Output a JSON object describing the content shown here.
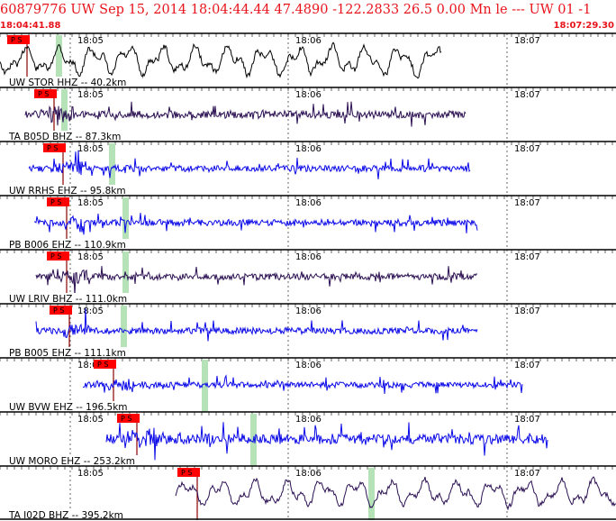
{
  "header": {
    "title": "60879776 UW Sep 15, 2014 18:04:44.44   47.4890 -122.2833 26.5 0.00 Mn le --- UW 01   -1",
    "start_time": "18:04:41.88",
    "end_time": "18:07:29.30"
  },
  "time_axis": {
    "tick_labels": [
      "18:05",
      "18:06",
      "18:07"
    ]
  },
  "colors": {
    "header_red": "#e8141c",
    "pick_box": "#ff0000",
    "s_window": "#b6e2b8",
    "trace_black": "#000000",
    "trace_purple": "#2a0f52",
    "trace_blue": "#0a08e8"
  },
  "traces": [
    {
      "label": "UW STOR HHZ -- 40.2km",
      "pick_label": "P S",
      "color": "#000000"
    },
    {
      "label": "TA B05D BHZ -- 87.3km",
      "pick_label": "P S",
      "color": "#2a0f52"
    },
    {
      "label": "UW RRHS EHZ -- 95.8km",
      "pick_label": "P S",
      "color": "#0a08e8"
    },
    {
      "label": "PB B006 EHZ -- 110.9km",
      "pick_label": "P S",
      "color": "#0a08e8"
    },
    {
      "label": "UW LRIV BHZ -- 111.0km",
      "pick_label": "P S",
      "color": "#2a0f52"
    },
    {
      "label": "PB B005 EHZ -- 111.1km",
      "pick_label": "P S",
      "color": "#0a08e8"
    },
    {
      "label": "UW BVW EHZ -- 196.5km",
      "pick_label": "P S",
      "color": "#0a08e8"
    },
    {
      "label": "UW MORO EHZ -- 253.2km",
      "pick_label": "P S",
      "color": "#0a08e8"
    },
    {
      "label": "TA I02D BHZ -- 395.2km",
      "pick_label": "P S",
      "color": "#2a0f52"
    }
  ]
}
